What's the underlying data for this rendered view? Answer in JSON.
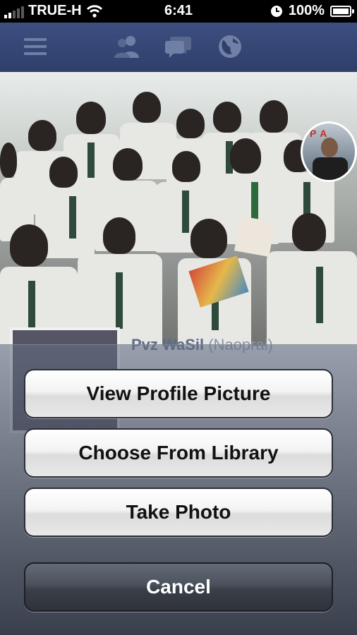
{
  "status_bar": {
    "carrier": "TRUE-H",
    "time": "6:41",
    "battery_percent": "100%",
    "battery_level": 1.0
  },
  "nav_bar": {
    "icons": [
      "menu-icon",
      "friends-icon",
      "messages-icon",
      "globe-icon"
    ]
  },
  "profile": {
    "name": "Pvz WaSil",
    "alt_name": "(Naoprai)"
  },
  "action_sheet": {
    "view_profile_picture": "View Profile Picture",
    "choose_from_library": "Choose From Library",
    "take_photo": "Take Photo",
    "cancel": "Cancel"
  },
  "colors": {
    "nav_bar": "#2e3f6b",
    "cancel_button": "#3a3f48"
  }
}
